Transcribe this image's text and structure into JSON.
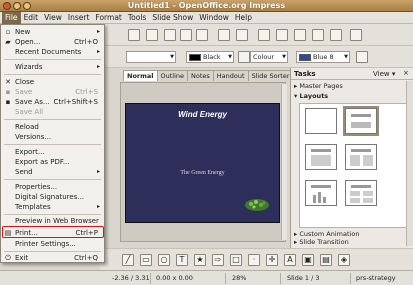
{
  "window": {
    "title": "Untitled1 - OpenOffice.org Impress"
  },
  "menubar": [
    "File",
    "Edit",
    "View",
    "Insert",
    "Format",
    "Tools",
    "Slide Show",
    "Window",
    "Help"
  ],
  "file_menu": {
    "items": [
      {
        "label": "New",
        "shortcut": "",
        "submenu": true,
        "disabled": false,
        "icon": "new-icon"
      },
      {
        "label": "Open...",
        "shortcut": "Ctrl+O",
        "submenu": false,
        "disabled": false,
        "icon": "open-folder-icon"
      },
      {
        "label": "Recent Documents",
        "shortcut": "",
        "submenu": true,
        "disabled": false,
        "icon": ""
      },
      {
        "label": "Wizards",
        "shortcut": "",
        "submenu": true,
        "disabled": false,
        "icon": ""
      },
      {
        "label": "Close",
        "shortcut": "",
        "submenu": false,
        "disabled": false,
        "icon": "close-x-icon"
      },
      {
        "label": "Save",
        "shortcut": "Ctrl+S",
        "submenu": false,
        "disabled": true,
        "icon": "save-icon"
      },
      {
        "label": "Save As...",
        "shortcut": "Ctrl+Shift+S",
        "submenu": false,
        "disabled": false,
        "icon": "save-as-icon"
      },
      {
        "label": "Save All",
        "shortcut": "",
        "submenu": false,
        "disabled": true,
        "icon": ""
      },
      {
        "label": "Reload",
        "shortcut": "",
        "submenu": false,
        "disabled": false,
        "icon": ""
      },
      {
        "label": "Versions...",
        "shortcut": "",
        "submenu": false,
        "disabled": false,
        "icon": ""
      },
      {
        "label": "Export...",
        "shortcut": "",
        "submenu": false,
        "disabled": false,
        "icon": ""
      },
      {
        "label": "Export as PDF...",
        "shortcut": "",
        "submenu": false,
        "disabled": false,
        "icon": ""
      },
      {
        "label": "Send",
        "shortcut": "",
        "submenu": true,
        "disabled": false,
        "icon": ""
      },
      {
        "label": "Properties...",
        "shortcut": "",
        "submenu": false,
        "disabled": false,
        "icon": ""
      },
      {
        "label": "Digital Signatures...",
        "shortcut": "",
        "submenu": false,
        "disabled": false,
        "icon": ""
      },
      {
        "label": "Templates",
        "shortcut": "",
        "submenu": true,
        "disabled": false,
        "icon": ""
      },
      {
        "label": "Preview in Web Browser",
        "shortcut": "",
        "submenu": false,
        "disabled": false,
        "icon": ""
      },
      {
        "label": "Print...",
        "shortcut": "Ctrl+P",
        "submenu": false,
        "disabled": false,
        "icon": "print-icon"
      },
      {
        "label": "Printer Settings...",
        "shortcut": "",
        "submenu": false,
        "disabled": false,
        "icon": ""
      },
      {
        "label": "Exit",
        "shortcut": "Ctrl+Q",
        "submenu": false,
        "disabled": false,
        "icon": "exit-icon"
      }
    ]
  },
  "toolbar": {
    "line_color": "Black",
    "fill_type": "Colour",
    "fill_color": "Blue 8"
  },
  "view_tabs": [
    "Normal",
    "Outline",
    "Notes",
    "Handout",
    "Slide Sorter"
  ],
  "slide": {
    "title": "Wind Energy",
    "subtitle": "The Green Energy"
  },
  "tasks_pane": {
    "title": "Tasks",
    "view_label": "View",
    "close_glyph": "×",
    "sections": [
      {
        "label": "Master Pages",
        "expanded": false
      },
      {
        "label": "Layouts",
        "expanded": true
      },
      {
        "label": "Custom Animation",
        "expanded": false
      },
      {
        "label": "Slide Transition",
        "expanded": false
      }
    ]
  },
  "statusbar": {
    "position": "-2.36 / 3.31",
    "size": "0.00 x 0.00",
    "zoom": "28%",
    "slide": "Slide 1 / 3",
    "master": "prs-strategy"
  },
  "colors": {
    "title_bar": "#b48a50",
    "slide_background": "#2e2e5a",
    "print_highlight": "#d8141b"
  }
}
